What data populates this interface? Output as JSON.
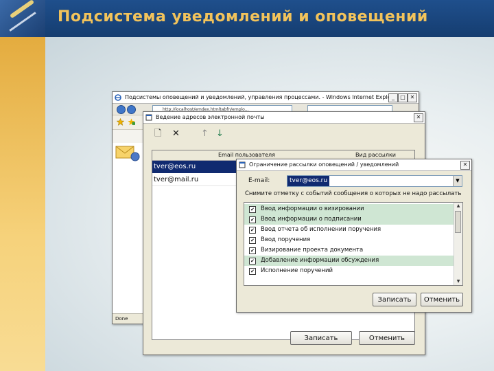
{
  "slide": {
    "title": "Подсистема уведомлений и оповещений"
  },
  "ie_window": {
    "title": "Подсистемы оповещений и уведомлений, управления процессами. - Windows Internet Explorer",
    "address": "http://localhost/emdex.htmltabfn/emplo...",
    "search_placeholder": "",
    "status": "Done"
  },
  "email_window": {
    "title": "Ведение адресов электронной почты",
    "toolbar": {
      "new": "🗋",
      "delete": "✕",
      "up": "↑",
      "down": "↓"
    },
    "columns": [
      "Email пользователя",
      "Вид рассылки"
    ],
    "rows": [
      "tver@eos.ru",
      "tver@mail.ru"
    ],
    "save_label": "Записать",
    "cancel_label": "Отменить"
  },
  "restriction_dialog": {
    "title": "Ограничение рассылки оповещений / уведомлений",
    "email_label": "E-mail:",
    "email_value": "tver@eos.ru",
    "hint": "Снимите отметку с событий сообщения о которых не надо рассылать",
    "events": [
      {
        "label": "Ввод информации о визировании",
        "checked": true,
        "highlight": true
      },
      {
        "label": "Ввод информации о подписании",
        "checked": true,
        "highlight": true
      },
      {
        "label": "Ввод отчета об исполнении поручения",
        "checked": true,
        "highlight": false
      },
      {
        "label": "Ввод поручения",
        "checked": true,
        "highlight": false
      },
      {
        "label": "Визирование проекта документа",
        "checked": true,
        "highlight": false
      },
      {
        "label": "Добавление информации обсуждения",
        "checked": true,
        "highlight": true
      },
      {
        "label": "Исполнение поручений",
        "checked": true,
        "highlight": false
      }
    ],
    "save_label": "Записать",
    "cancel_label": "Отменить"
  }
}
